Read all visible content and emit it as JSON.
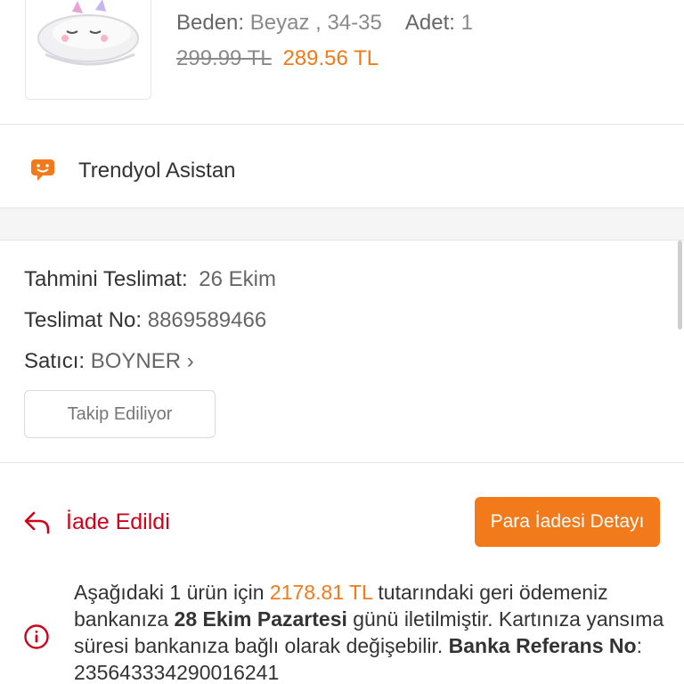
{
  "product": {
    "size_label": "Beden:",
    "size_value": "Beyaz , 34-35",
    "qty_label": "Adet:",
    "qty_value": "1",
    "old_price": "299.99 TL",
    "new_price": "289.56 TL",
    "image_icon": "slipper-image"
  },
  "assistant": {
    "icon": "chat-bubble-icon",
    "label": "Trendyol Asistan"
  },
  "shipment": {
    "delivery_label": "Tahmini Teslimat:",
    "delivery_value": "26 Ekim",
    "tracking_label": "Teslimat No:",
    "tracking_value": "8869589466",
    "seller_label": "Satıcı:",
    "seller_value": "BOYNER",
    "seller_chevron": "›",
    "follow_button": "Takip Ediliyor"
  },
  "refund": {
    "status_icon": "return-arrow-icon",
    "status": "İade Edildi",
    "detail_button": "Para İadesi Detayı",
    "info": {
      "icon": "info-circle-icon",
      "t1": "Aşağıdaki 1 ürün için ",
      "amount": "2178.81 TL",
      "t2": " tutarındaki geri ödemeniz bankanıza ",
      "date": "28 Ekim Pazartesi",
      "t3": " günü iletilmiştir. Kartınıza yansıma süresi bankanıza bağlı olarak değişebilir. ",
      "ref_label": "Banka Referans No",
      "t4": ": ",
      "ref_value": "235643334290016241"
    }
  },
  "colors": {
    "accent": "#f27a1a",
    "status_red": "#d0021b",
    "text": "#333333",
    "muted": "#666666",
    "border": "#e6e6e6"
  }
}
